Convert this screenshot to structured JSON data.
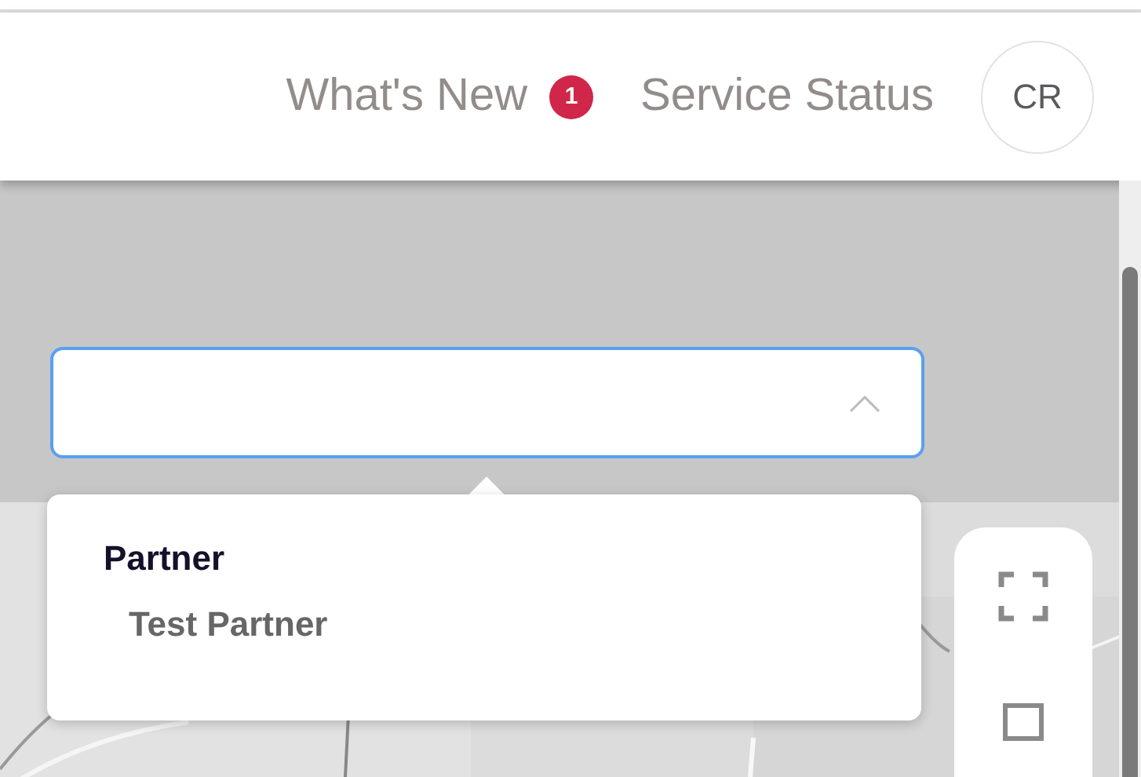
{
  "header": {
    "links": [
      {
        "label": "What's New",
        "badge": "1"
      },
      {
        "label": "Service Status"
      }
    ],
    "avatar": {
      "initials": "CR"
    }
  },
  "filter": {
    "dropdown": {
      "expanded": true
    }
  },
  "dropdown_menu": {
    "groups": [
      {
        "title": "Partner",
        "items": [
          {
            "label": "Test Partner"
          }
        ]
      }
    ]
  }
}
